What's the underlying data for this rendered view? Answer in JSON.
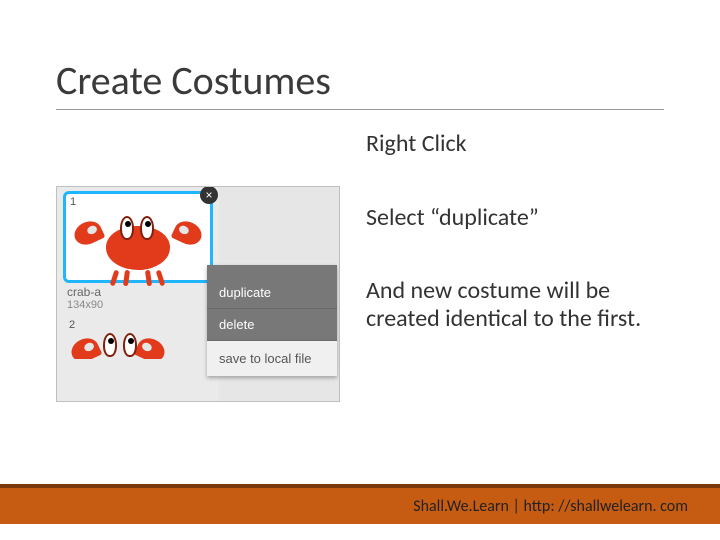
{
  "title": "Create Costumes",
  "steps": {
    "s1": "Right Click",
    "s2": "Select “duplicate”",
    "s3": "And new costume will be created identical to the first."
  },
  "panel": {
    "thumb1_number": "1",
    "thumb1_name": "crab-a",
    "thumb1_dims": "134x90",
    "thumb2_number": "2",
    "menu": {
      "duplicate": "duplicate",
      "delete": "delete",
      "save": "save to local file"
    }
  },
  "footer": "Shall.We.Learn | http: //shallwelearn. com"
}
